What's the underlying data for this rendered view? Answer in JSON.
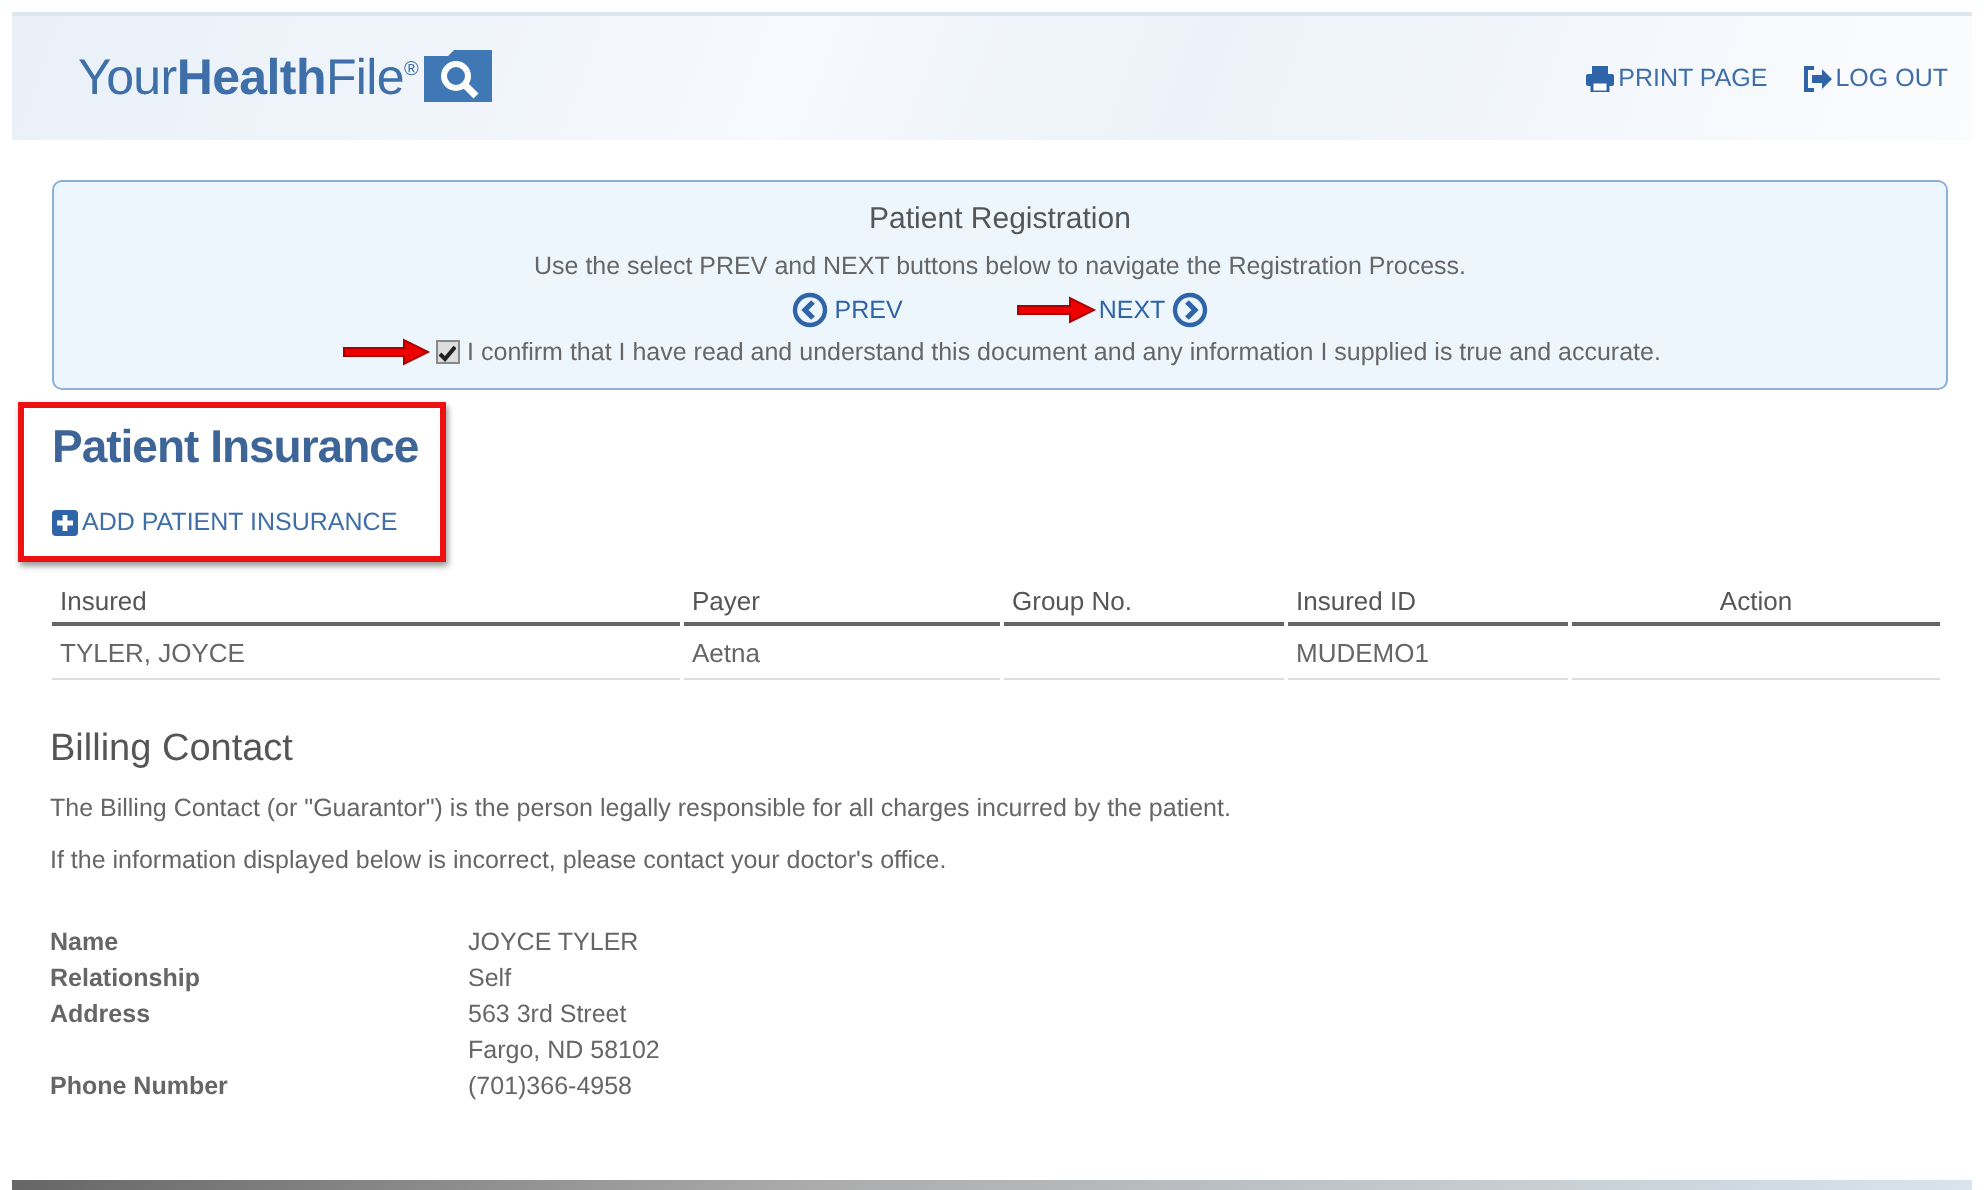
{
  "header": {
    "logo": "Your**Health**File$^{®}$",
    "links": [
      {
        "kind": "print",
        "label": "PRINT PAGE"
      },
      {
        "kind": "logout",
        "label": "LOG OUT"
      }
    ]
  },
  "registration": {
    "title": "Patient Registration",
    "instructions": "Use the select PREV and NEXT buttons below to navigate the Registration Process.",
    "prev": "PREV",
    "next": "NEXT",
    "confirm": {
      "label": "I confirm that I have read and understand this document and any information I supplied is true and accurate.",
      "checked": true
    }
  },
  "insurance": {
    "title": "Patient Insurance",
    "add_link": "ADD PATIENT INSURANCE",
    "table": {
      "columns": [
        "Insured",
        "Payer",
        "Group No.",
        "Insured ID",
        "Action"
      ],
      "rows": [
        [
          "TYLER, JOYCE",
          "Aetna",
          "",
          "MUDEMO1",
          ""
        ]
      ]
    }
  },
  "billing": {
    "title": "Billing Contact",
    "paragraphs": [
      "The Billing Contact (or \"Guarantor\") is the person legally responsible for all charges incurred by the patient.",
      "If the information displayed below is incorrect, please contact your doctor's office."
    ],
    "fields": [
      {
        "label": "Name",
        "values": [
          "JOYCE TYLER"
        ]
      },
      {
        "label": "Relationship",
        "values": [
          "Self"
        ]
      },
      {
        "label": "Address",
        "values": [
          "563 3rd Street",
          "Fargo, ND 58102"
        ]
      },
      {
        "label": "Phone Number",
        "values": [
          "(701)366-4958"
        ]
      }
    ]
  }
}
